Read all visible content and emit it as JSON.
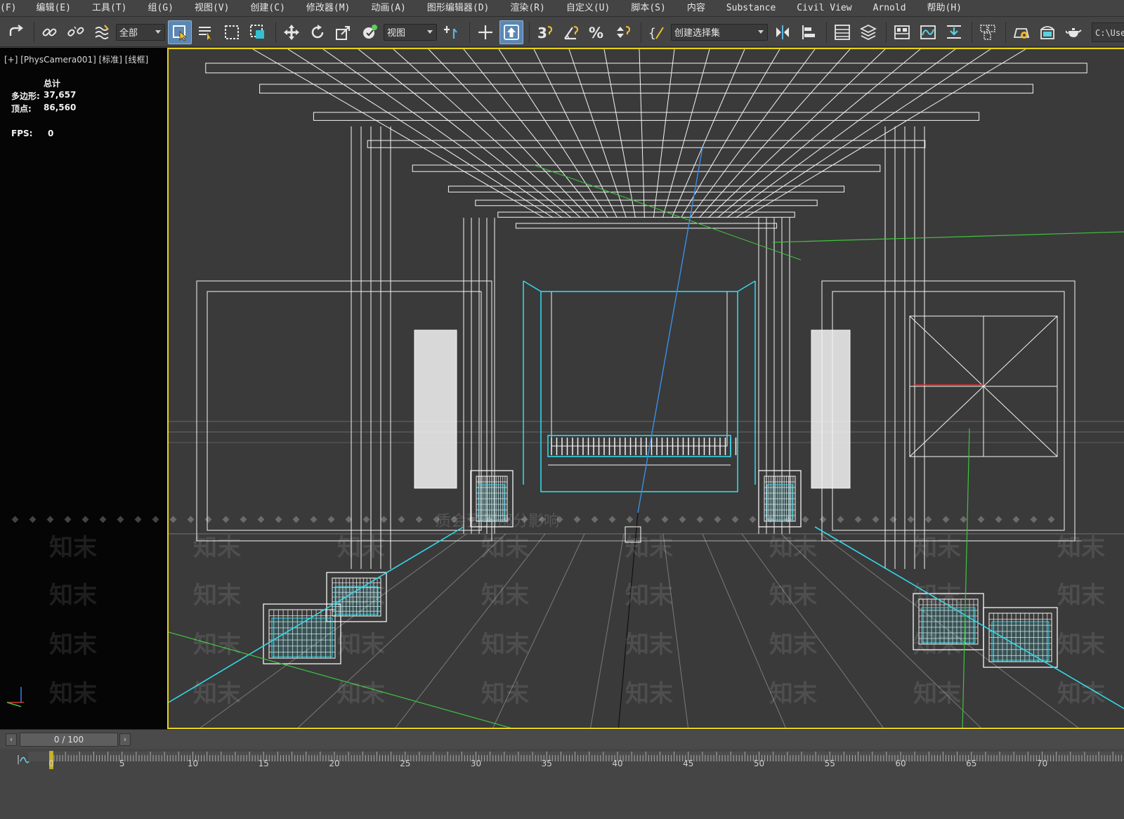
{
  "menu": {
    "items": [
      "(F)",
      "编辑(E)",
      "工具(T)",
      "组(G)",
      "视图(V)",
      "创建(C)",
      "修改器(M)",
      "动画(A)",
      "图形编辑器(D)",
      "渲染(R)",
      "自定义(U)",
      "脚本(S)",
      "内容",
      "Substance",
      "Civil View",
      "Arnold",
      "帮助(H)"
    ]
  },
  "toolbar": {
    "selection_filter": "全部",
    "reference_coord": "视图",
    "named_selection": "创建选择集",
    "path": "C:\\Use"
  },
  "viewport": {
    "label": "[+] [PhysCamera001] [标准] [线框]",
    "stats_header": "总计",
    "polys_label": "多边形:",
    "polys_value": "37,657",
    "verts_label": "顶点:",
    "verts_value": "86,560",
    "fps_label": "FPS:",
    "fps_value": "0"
  },
  "timeline": {
    "frame_display": "0 / 100",
    "ticks": [
      "0",
      "5",
      "10",
      "15",
      "20",
      "25",
      "30",
      "35",
      "40",
      "45",
      "50",
      "55",
      "60",
      "65",
      "70"
    ]
  },
  "watermark": {
    "text": "知末",
    "notice": "质会受到部分影响"
  },
  "colors": {
    "viewport_border": "#e7d21b",
    "wire_white": "#ffffff",
    "wire_cyan": "#33d6e6",
    "wire_green": "#3ec43e",
    "wire_blue": "#3a8ee6",
    "active_button": "#5b87b3"
  }
}
